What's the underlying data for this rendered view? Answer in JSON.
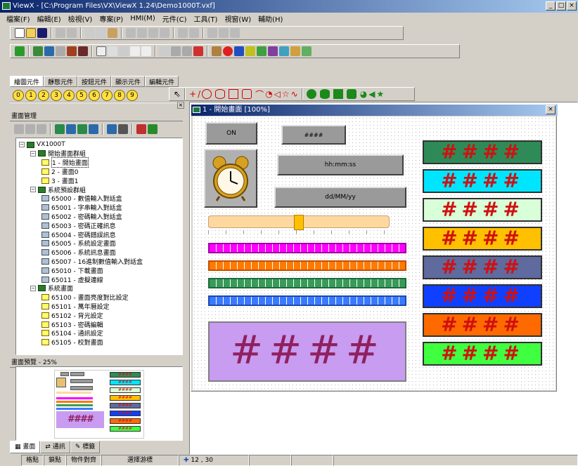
{
  "window": {
    "title": "ViewX - [C:\\Program Files\\VX\\ViewX 1.24\\Demo1000T.vxf]"
  },
  "menu": [
    "檔案(F)",
    "編輯(E)",
    "檢視(V)",
    "專案(P)",
    "HMI(M)",
    "元件(C)",
    "工具(T)",
    "視窗(W)",
    "輔助(H)"
  ],
  "tool_tabs": [
    "繪圖元件",
    "靜態元件",
    "按鈕元件",
    "顯示元件",
    "編輯元件"
  ],
  "layer_buttons": [
    "0",
    "1",
    "2",
    "3",
    "4",
    "5",
    "6",
    "7",
    "8",
    "9"
  ],
  "panel": {
    "title": "畫面管理",
    "preview_title": "畫面預覽 - 25%"
  },
  "tree": [
    {
      "label": "VX1000T",
      "level": 0,
      "kind": "root"
    },
    {
      "label": "開始畫面群組",
      "level": 1,
      "kind": "folder"
    },
    {
      "label": "1 - 開始畫面",
      "level": 2,
      "kind": "screen",
      "selected": true
    },
    {
      "label": "2 - 畫面0",
      "level": 2,
      "kind": "screen"
    },
    {
      "label": "3 - 畫面1",
      "level": 2,
      "kind": "screen"
    },
    {
      "label": "系統預設群組",
      "level": 1,
      "kind": "folder"
    },
    {
      "label": "65000 - 數值輸入對話盒",
      "level": 2,
      "kind": "dialog"
    },
    {
      "label": "65001 - 字串輸入對話盒",
      "level": 2,
      "kind": "dialog"
    },
    {
      "label": "65002 - 密碼輸入對話盒",
      "level": 2,
      "kind": "dialog"
    },
    {
      "label": "65003 - 密碼正確訊息",
      "level": 2,
      "kind": "dialog"
    },
    {
      "label": "65004 - 密碼錯誤訊息",
      "level": 2,
      "kind": "dialog"
    },
    {
      "label": "65005 - 系統設定畫面",
      "level": 2,
      "kind": "dialog"
    },
    {
      "label": "65006 - 系統訊息畫面",
      "level": 2,
      "kind": "dialog"
    },
    {
      "label": "65007 - 16進制數值輸入對話盒",
      "level": 2,
      "kind": "dialog"
    },
    {
      "label": "65010 - 下載畫面",
      "level": 2,
      "kind": "dialog"
    },
    {
      "label": "65011 - 虛擬連線",
      "level": 2,
      "kind": "dialog"
    },
    {
      "label": "系統畫面",
      "level": 1,
      "kind": "folder"
    },
    {
      "label": "65100 - 畫面亮度對比設定",
      "level": 2,
      "kind": "screen"
    },
    {
      "label": "65101 - 萬年曆設定",
      "level": 2,
      "kind": "screen"
    },
    {
      "label": "65102 - 背光設定",
      "level": 2,
      "kind": "screen"
    },
    {
      "label": "65103 - 密碼編輯",
      "level": 2,
      "kind": "screen"
    },
    {
      "label": "65104 - 通訊設定",
      "level": 2,
      "kind": "screen"
    },
    {
      "label": "65105 - 校對畫面",
      "level": 2,
      "kind": "screen"
    }
  ],
  "bottom_tabs": [
    "畫面",
    "通訊",
    "標籤"
  ],
  "mdi": {
    "title": "1 - 開始畫面 [100%]"
  },
  "screen": {
    "on_button": "ON",
    "num_display": "####",
    "time_display": "hh:mm:ss",
    "date_display": "dd/MM/yy",
    "slider_value": 0.5,
    "big_display": "####",
    "displays": [
      {
        "text": "####",
        "bg": "#2e8b57"
      },
      {
        "text": "####",
        "bg": "#00e5ff"
      },
      {
        "text": "####",
        "bg": "#d8ffd8"
      },
      {
        "text": "####",
        "bg": "#ffc000"
      },
      {
        "text": "####",
        "bg": "#5f6a9e"
      },
      {
        "text": "####",
        "bg": "#1040ff"
      },
      {
        "text": "####",
        "bg": "#ff6a00"
      },
      {
        "text": "####",
        "bg": "#40ff40"
      }
    ],
    "bars": [
      {
        "color": "#ff00ff",
        "border": "#a000a0"
      },
      {
        "color": "#ff7a00",
        "border": "#c05000"
      },
      {
        "color": "#3a9a5a",
        "border": "#1a6a3a"
      },
      {
        "color": "#3a7aff",
        "border": "#1a4aaa"
      }
    ],
    "big_bg": "#c89cf0"
  },
  "status": [
    "格點",
    "鎖點",
    "物件對齊",
    "選擇游標",
    "12 , 30"
  ]
}
